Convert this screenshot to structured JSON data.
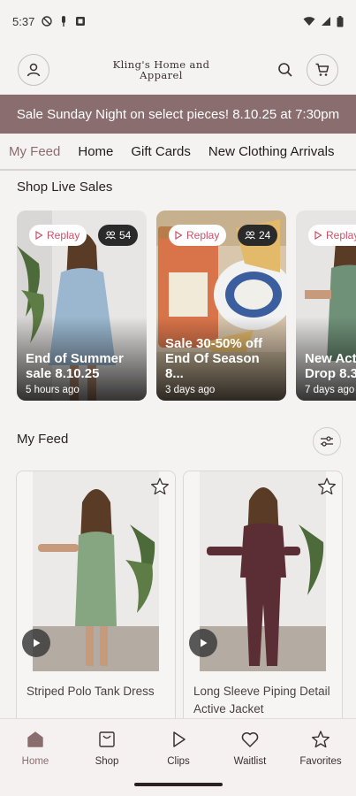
{
  "status_bar": {
    "time": "5:37",
    "icons_left": [
      "do-not-disturb-icon",
      "media-icon",
      "notification-icon"
    ],
    "icons_right": [
      "wifi-icon",
      "signal-icon",
      "battery-icon"
    ]
  },
  "header": {
    "brand_line1": "Kling's Home and",
    "brand_line2": "Apparel",
    "account_icon": "user-icon",
    "search_icon": "search-icon",
    "cart_icon": "cart-icon"
  },
  "promo_banner": {
    "text": "Sale Sunday Night on select pieces! 8.10.25 at 7:30pm"
  },
  "tabs": [
    {
      "label": "My Feed",
      "active": true
    },
    {
      "label": "Home",
      "active": false
    },
    {
      "label": "Gift Cards",
      "active": false
    },
    {
      "label": "New Clothing Arrivals",
      "active": false
    }
  ],
  "live_sales": {
    "section_title": "Shop Live Sales",
    "items": [
      {
        "replay_label": "Replay",
        "viewers": "54",
        "title": "End of Summer\nsale 8.10.25",
        "time": "5 hours ago"
      },
      {
        "replay_label": "Replay",
        "viewers": "24",
        "title": "Sale 30-50% off\nEnd Of Season 8...",
        "time": "3 days ago"
      },
      {
        "replay_label": "Replay",
        "viewers": "",
        "title": "New Act\nDrop 8.3",
        "time": "7 days ago"
      }
    ]
  },
  "feed": {
    "section_title": "My Feed",
    "filter_icon": "filter-sliders-icon",
    "products": [
      {
        "name": "Striped Polo Tank Dress"
      },
      {
        "name": "Long Sleeve Piping Detail Active Jacket"
      }
    ]
  },
  "bottom_nav": [
    {
      "label": "Home",
      "icon": "home-icon",
      "active": true
    },
    {
      "label": "Shop",
      "icon": "shop-bag-icon",
      "active": false
    },
    {
      "label": "Clips",
      "icon": "play-icon",
      "active": false
    },
    {
      "label": "Waitlist",
      "icon": "heart-icon",
      "active": false
    },
    {
      "label": "Favorites",
      "icon": "star-icon",
      "active": false
    }
  ],
  "colors": {
    "accent": "#8a6d6e",
    "replay_text": "#c8516a",
    "background": "#f5f2f2"
  }
}
